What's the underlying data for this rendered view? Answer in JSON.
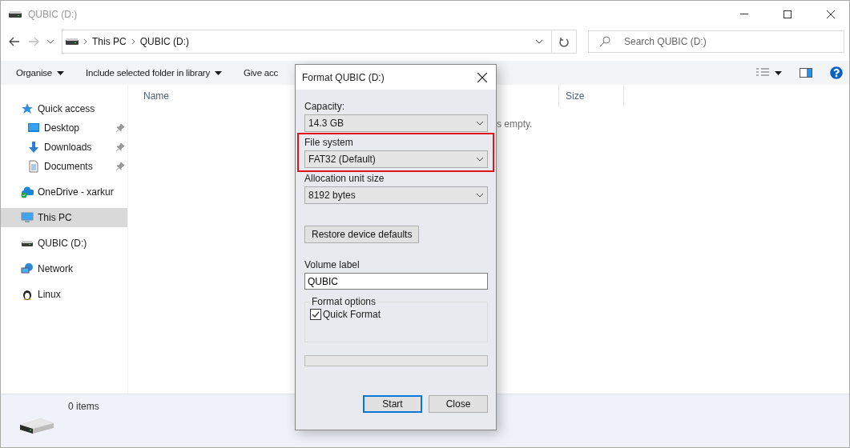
{
  "window": {
    "title": "QUBIC (D:)"
  },
  "address_bar": {
    "path": [
      "This PC",
      "QUBIC (D:)"
    ]
  },
  "search": {
    "placeholder": "Search QUBIC (D:)"
  },
  "toolbar": {
    "items": [
      "Organise",
      "Include selected folder in library",
      "Give acc"
    ]
  },
  "sidebar": {
    "items": [
      {
        "label": "Quick access",
        "kind": "star",
        "selected": false,
        "pinned": false,
        "children": [
          {
            "label": "Desktop",
            "kind": "desktop",
            "selected": false,
            "pinned": true
          },
          {
            "label": "Downloads",
            "kind": "download",
            "selected": false,
            "pinned": true
          },
          {
            "label": "Documents",
            "kind": "document",
            "selected": false,
            "pinned": true
          }
        ]
      },
      {
        "label": "OneDrive - xarkur",
        "kind": "cloud",
        "selected": false,
        "pinned": false
      },
      {
        "label": "This PC",
        "kind": "pc",
        "selected": true,
        "pinned": false
      },
      {
        "label": "QUBIC (D:)",
        "kind": "drive",
        "selected": false,
        "pinned": false
      },
      {
        "label": "Network",
        "kind": "network",
        "selected": false,
        "pinned": false
      },
      {
        "label": "Linux",
        "kind": "penguin",
        "selected": false,
        "pinned": false
      }
    ]
  },
  "table": {
    "columns": [
      "Name",
      "Size"
    ],
    "empty_message": "s empty."
  },
  "status_bar": {
    "count": "0 items"
  },
  "dialog": {
    "title": "Format QUBIC (D:)",
    "fields": [
      {
        "label": "Capacity:",
        "value": "14.3 GB",
        "highlighted": false
      },
      {
        "label": "File system",
        "value": "FAT32 (Default)",
        "highlighted": true
      },
      {
        "label": "Allocation unit size",
        "value": "8192 bytes",
        "highlighted": false
      }
    ],
    "restore_button": "Restore device defaults",
    "volume_label": {
      "label": "Volume label",
      "value": "QUBIC"
    },
    "format_options": {
      "title": "Format options",
      "quick_format": {
        "label": "Quick Format",
        "checked": true
      }
    },
    "progress": {
      "level": 0
    },
    "buttons": [
      {
        "label": "Start",
        "selected": true
      },
      {
        "label": "Close",
        "selected": false
      }
    ]
  }
}
